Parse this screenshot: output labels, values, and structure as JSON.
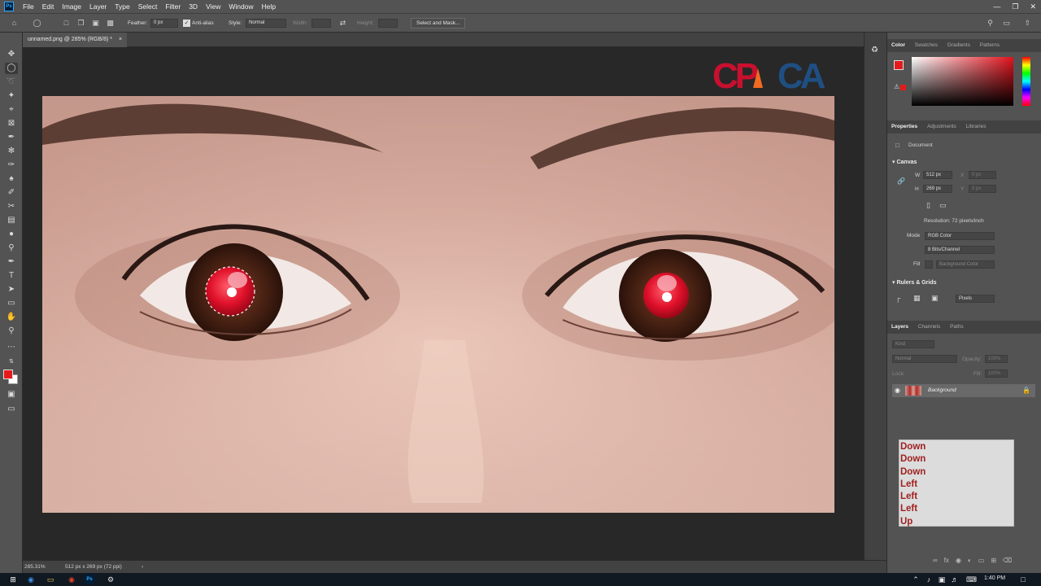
{
  "menubar": {
    "logo": "Ps",
    "items": [
      "File",
      "Edit",
      "Image",
      "Layer",
      "Type",
      "Select",
      "Filter",
      "3D",
      "View",
      "Window",
      "Help"
    ]
  },
  "options": {
    "feather_label": "Feather:",
    "feather_value": "0 px",
    "antialias_label": "Anti-alias",
    "style_label": "Style:",
    "style_value": "Normal",
    "width_label": "Width:",
    "height_label": "Height:",
    "select_mask_label": "Select and Mask..."
  },
  "document": {
    "tab_title": "unnamed.png @ 285% (RGB/8) *",
    "zoom": "285.31%",
    "doc_info": "512 px x 269 px (72 ppi)"
  },
  "logo_text": "CPCA",
  "color_panel": {
    "tabs": [
      "Color",
      "Swatches",
      "Gradients",
      "Patterns"
    ],
    "fg_color": "#e51b1b"
  },
  "properties_panel": {
    "tabs": [
      "Properties",
      "Adjustments",
      "Libraries"
    ],
    "document_label": "Document",
    "canvas_section": "Canvas",
    "w_label": "W",
    "w_value": "512 px",
    "h_label": "H",
    "h_value": "269 px",
    "x_label": "X",
    "x_value": "0 px",
    "y_label": "Y",
    "y_value": "0 px",
    "resolution": "Resolution: 72 pixels/inch",
    "mode_label": "Mode",
    "mode_value": "RGB Color",
    "depth_value": "8 Bits/Channel",
    "fill_label": "Fill",
    "fill_value": "Background Color",
    "rulers_section": "Rulers & Grids",
    "units_value": "Pixels"
  },
  "layers_panel": {
    "tabs": [
      "Layers",
      "Channels",
      "Paths"
    ],
    "kind_placeholder": "Kind",
    "blend_mode": "Normal",
    "opacity_label": "Opacity:",
    "opacity_value": "100%",
    "lock_label": "Lock:",
    "fill_label": "Fill:",
    "fill_value": "100%",
    "layer_name": "Background"
  },
  "key_log": [
    "Down",
    "Down",
    "Down",
    "Left",
    "Left",
    "Left",
    "Up"
  ],
  "taskbar": {
    "time": "1:40 PM"
  }
}
